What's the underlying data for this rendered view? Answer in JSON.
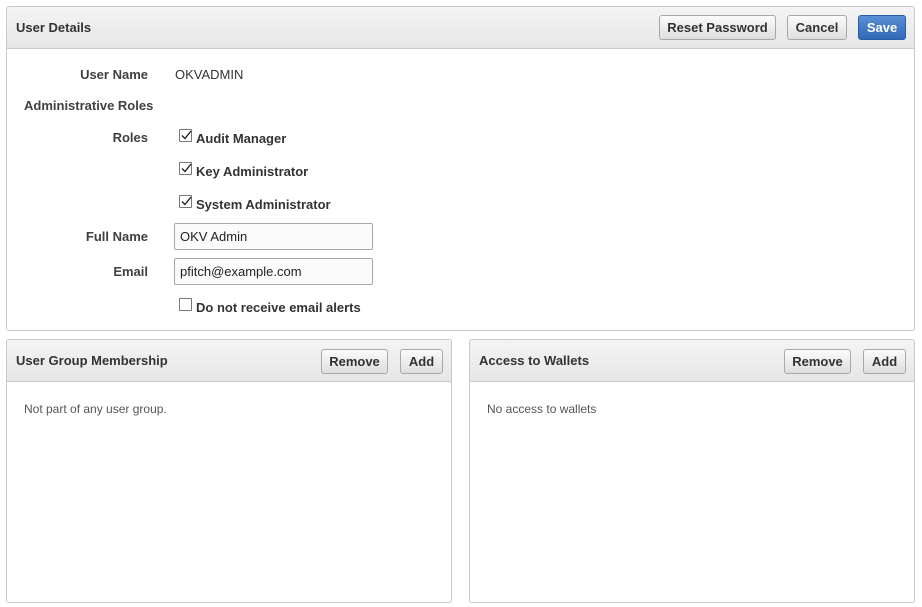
{
  "user_details": {
    "title": "User Details",
    "reset_password_label": "Reset Password",
    "cancel_label": "Cancel",
    "save_label": "Save",
    "user_name_label": "User Name",
    "user_name_value": "OKVADMIN",
    "admin_roles_label": "Administrative Roles",
    "roles_label": "Roles",
    "roles": [
      {
        "label": "Audit Manager",
        "checked": true
      },
      {
        "label": "Key Administrator",
        "checked": true
      },
      {
        "label": "System Administrator",
        "checked": true
      }
    ],
    "full_name_label": "Full Name",
    "full_name_value": "OKV Admin",
    "email_label": "Email",
    "email_value": "pfitch@example.com",
    "email_alerts_label": "Do not receive email alerts",
    "email_alerts_checked": false
  },
  "user_group_membership": {
    "title": "User Group Membership",
    "remove_label": "Remove",
    "add_label": "Add",
    "empty_message": "Not part of any user group."
  },
  "access_to_wallets": {
    "title": "Access to Wallets",
    "remove_label": "Remove",
    "add_label": "Add",
    "empty_message": "No access to wallets"
  },
  "colors": {
    "primary_button": "#2f69b8",
    "header_bg": "#e9e9e9",
    "border": "#c9c9c9"
  }
}
